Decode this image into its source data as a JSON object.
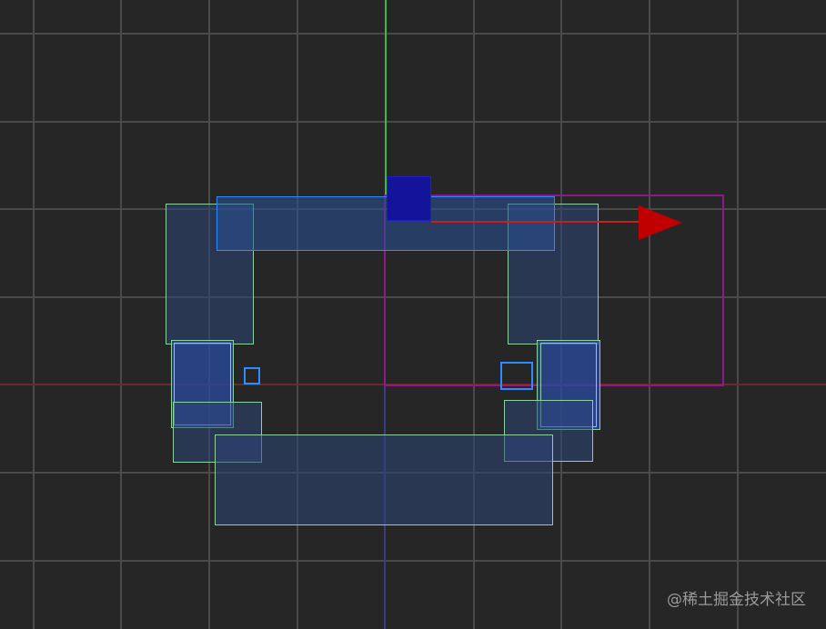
{
  "scene": {
    "background": "#262626",
    "grid_color": "#4a4a4a",
    "x_axis_color": "#6a2a2a",
    "y_axis_color": "#3dbd3d",
    "node_border_color": "#8fd19e",
    "selected_border_color": "#2f8cff",
    "parent_border_color": "#8a1a8a"
  },
  "gizmo": {
    "handle_icon": "move-plane-handle-icon",
    "x_arrow_icon": "x-axis-arrow-icon",
    "handle_color": "#14149a",
    "arrow_color": "#c00000"
  },
  "watermark": {
    "text": "@稀土掘金技术社区"
  }
}
